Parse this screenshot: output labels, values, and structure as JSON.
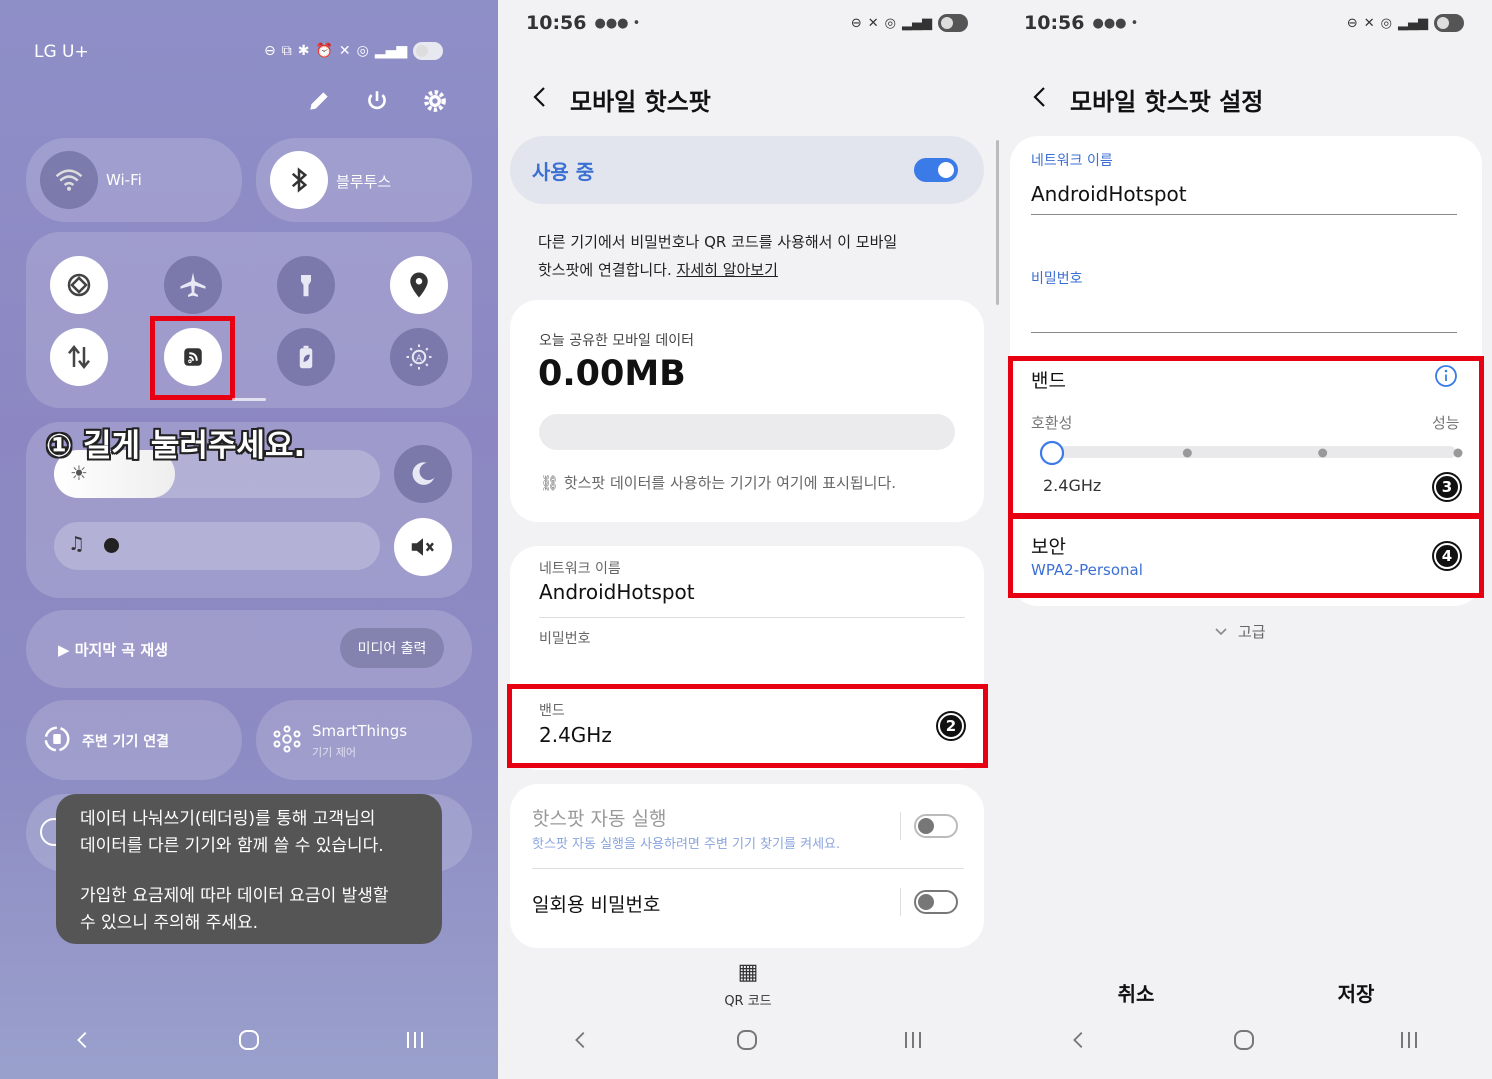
{
  "panel1": {
    "carrier": "LG U+",
    "tiles": {
      "wifi_label": "Wi-Fi",
      "bluetooth_label": "블루투스"
    },
    "instruction": "① 길게 눌러주세요.",
    "media": {
      "last_song": "▶ 마지막 곡 재생",
      "media_output": "미디어 출력"
    },
    "nearby_devices": "주변 기기 연결",
    "smartthings": {
      "title": "SmartThings",
      "subtitle": "기기 제어"
    },
    "toast": {
      "line1": "데이터 나눠쓰기(테더링)를 통해 고객님의",
      "line2": "데이터를 다른 기기와 함께 쓸 수 있습니다.",
      "line3": "가입한 요금제에 따라 데이터 요금이 발생할",
      "line4": "수 있으니 주의해 주세요."
    }
  },
  "panel2": {
    "time": "10:56",
    "title": "모바일 핫스팟",
    "in_use_label": "사용 중",
    "in_use_on": true,
    "description_line1": "다른 기기에서 비밀번호나 QR 코드를 사용해서 이 모바일",
    "description_line2": "핫스팟에 연결합니다.",
    "learn_more": "자세히 알아보기",
    "data_title": "오늘 공유한 모바일 데이터",
    "data_value": "0.00MB",
    "devices_hint": "핫스팟 데이터를 사용하는 기기가 여기에 표시됩니다.",
    "network_name_label": "네트워크 이름",
    "network_name_value": "AndroidHotspot",
    "password_label": "비밀번호",
    "band_label": "밴드",
    "band_value": "2.4GHz",
    "badge2": "2",
    "auto_run_title": "핫스팟 자동 실행",
    "auto_run_sub": "핫스팟 자동 실행을 사용하려면 주변 기기 찾기를 켜세요.",
    "one_time_pw": "일회용 비밀번호",
    "qr_label": "QR 코드"
  },
  "panel3": {
    "time": "10:56",
    "title": "모바일 핫스팟 설정",
    "network_name_label": "네트워크 이름",
    "network_name_value": "AndroidHotspot",
    "password_label": "비밀번호",
    "band_label": "밴드",
    "compat_label": "호환성",
    "perf_label": "성능",
    "band_value": "2.4GHz",
    "band_level": 0,
    "badge3": "3",
    "security_label": "보안",
    "security_value": "WPA2-Personal",
    "badge4": "4",
    "advanced": "고급",
    "cancel": "취소",
    "save": "저장"
  },
  "colors": {
    "accent_blue": "#3a7be8",
    "highlight_red": "#e60012",
    "link_blue": "#3b6fd4"
  }
}
